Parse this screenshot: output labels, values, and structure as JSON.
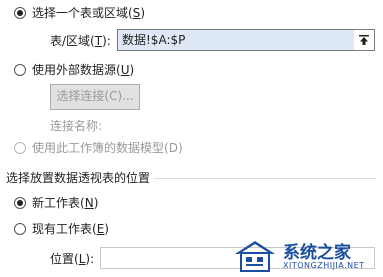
{
  "source_section": {
    "radio_select_table": {
      "label": "选择一个表或区域",
      "hotkey": "S",
      "selected": true
    },
    "table_range": {
      "label": "表/区域",
      "hotkey": "T",
      "value": "数据!$A:$P"
    },
    "radio_external": {
      "label": "使用外部数据源",
      "hotkey": "U",
      "selected": false
    },
    "choose_connection_button": "选择连接(C)...",
    "connection_name_label": "连接名称:",
    "radio_data_model": {
      "label": "使用此工作簿的数据模型",
      "hotkey": "D",
      "selected": false
    }
  },
  "location_section": {
    "title": "选择放置数据透视表的位置",
    "radio_new_sheet": {
      "label": "新工作表",
      "hotkey": "N",
      "selected": true
    },
    "radio_existing_sheet": {
      "label": "现有工作表",
      "hotkey": "E",
      "selected": false
    },
    "location_field": {
      "label": "位置",
      "hotkey": "L",
      "value": ""
    }
  },
  "watermark": {
    "title": "系统之家",
    "url": "XITONGZHIJIA.NET"
  },
  "icons": {
    "range_selector": "range-select-icon"
  }
}
